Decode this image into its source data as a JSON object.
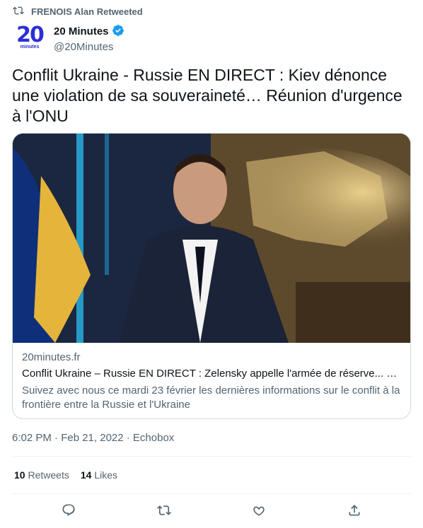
{
  "retweet": {
    "label": "FRENOIS Alan Retweeted"
  },
  "author": {
    "avatar_text": "20",
    "avatar_sub": "minutes",
    "display_name": "20 Minutes",
    "handle": "@20Minutes",
    "verified_icon": "verified-badge-icon"
  },
  "tweet": {
    "text": "Conflit Ukraine - Russie EN DIRECT : Kiev dénonce une violation de sa souveraineté… Réunion d'urgence à l'ONU"
  },
  "card": {
    "domain": "20minutes.fr",
    "title": "Conflit Ukraine – Russie EN DIRECT : Zelensky appelle l'armée de réserve... Le ...",
    "description": "Suivez avec nous ce mardi 23 février les dernières informations sur le conflit à la frontière entre la Russie et l'Ukraine"
  },
  "meta": {
    "timestamp": "6:02 PM · Feb 21, 2022 · Echobox"
  },
  "stats": {
    "retweets_count": "10",
    "retweets_label": "Retweets",
    "likes_count": "14",
    "likes_label": "Likes"
  },
  "colors": {
    "accent": "#1d9bf0",
    "muted": "#536471",
    "brand": "#2b2fd8"
  }
}
